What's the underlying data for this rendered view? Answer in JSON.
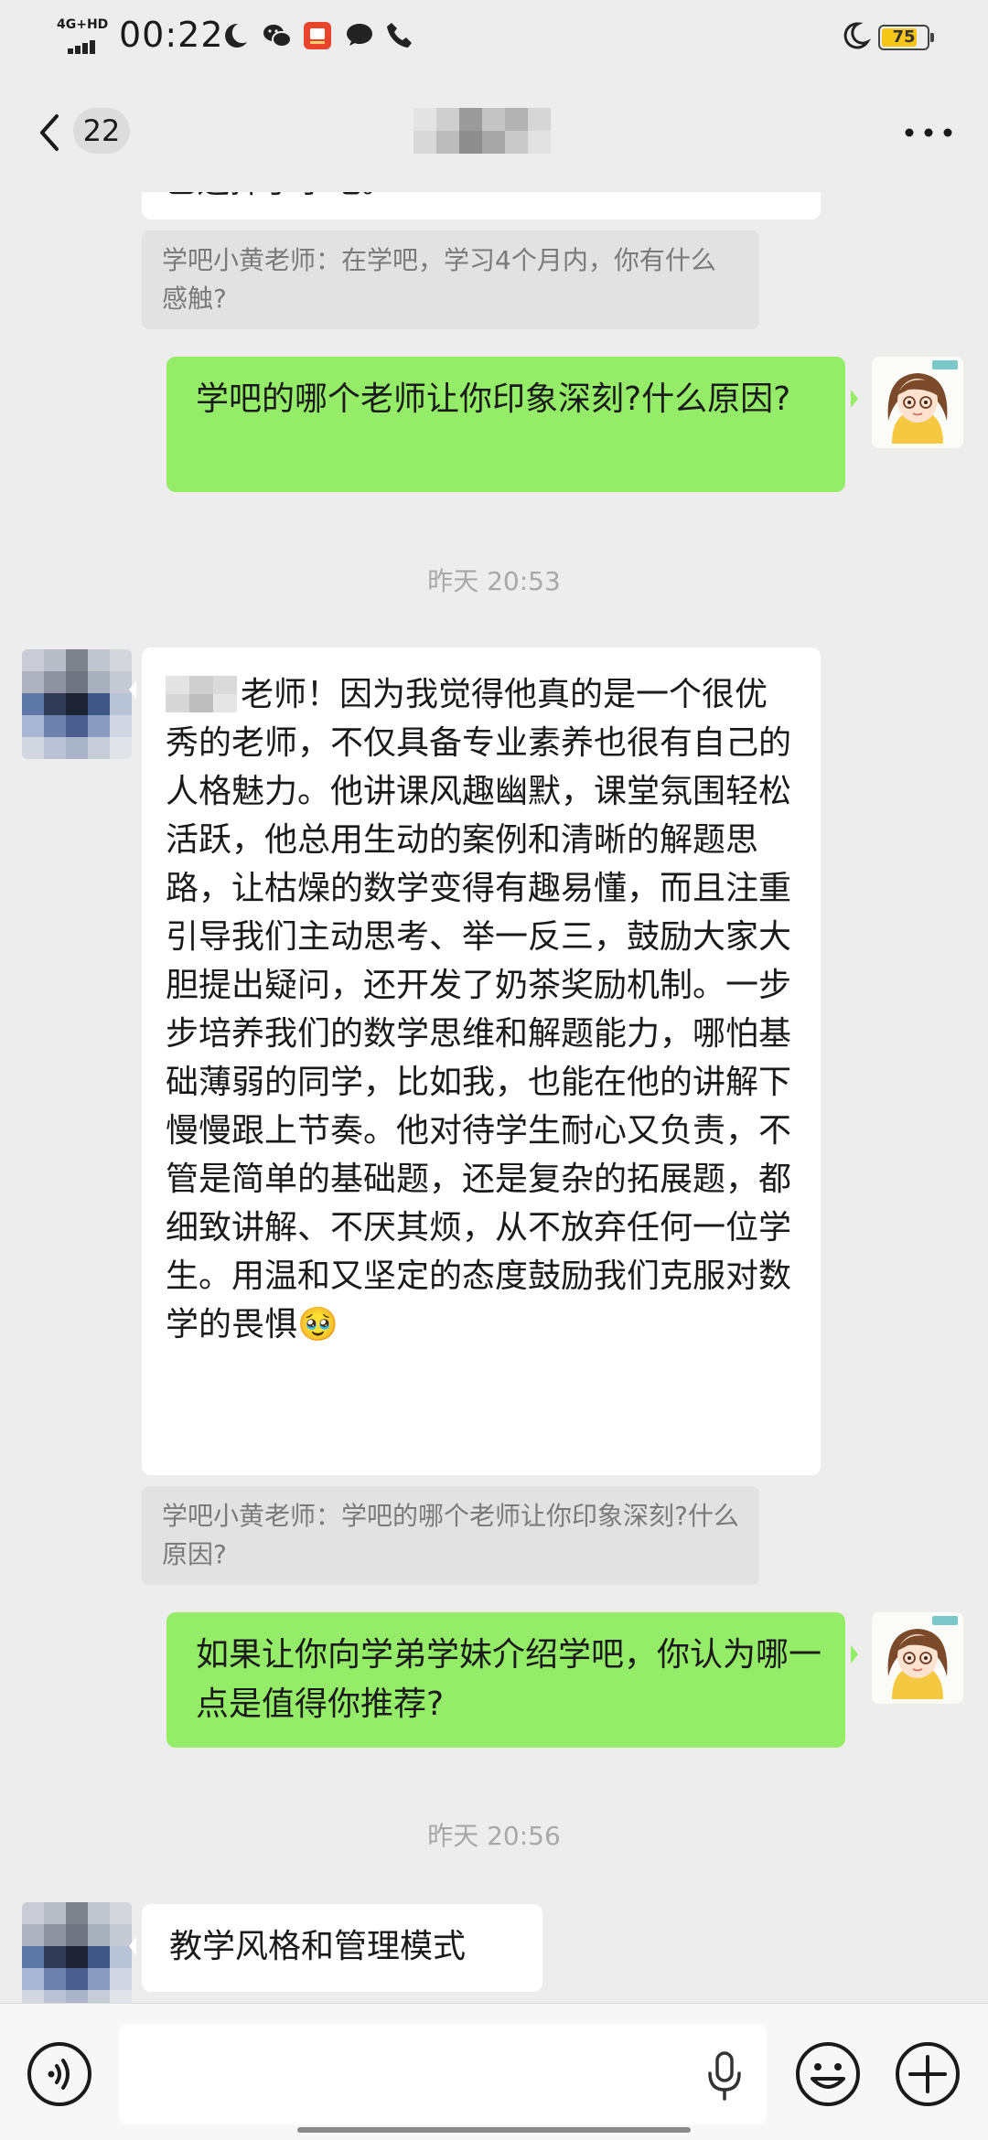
{
  "status_bar": {
    "network": "4G+HD",
    "time": "00:22",
    "icons": [
      "moon-icon",
      "wechat-icon",
      "app-notification-icon",
      "chat-bubble-icon",
      "phone-icon"
    ],
    "battery": "75"
  },
  "header": {
    "back_icon": "chevron-left-icon",
    "unread_count": "22",
    "more_icon": "more-dots-icon"
  },
  "messages": {
    "top_partial_text": "已选择了学吧。",
    "quote_1": "学吧小黄老师：在学吧，学习4个月内，你有什么感触?",
    "sent_1": "学吧的哪个老师让你印象深刻?什么原因?",
    "timestamp_1": "昨天 20:53",
    "reply_1": "老师！因为我觉得他真的是一个很优秀的老师，不仅具备专业素养也很有自己的人格魅力。他讲课风趣幽默，课堂氛围轻松活跃，他总用生动的案例和清晰的解题思路，让枯燥的数学变得有趣易懂，而且注重引导我们主动思考、举一反三，鼓励大家大胆提出疑问，还开发了奶茶奖励机制。一步步培养我们的数学思维和解题能力，哪怕基础薄弱的同学，比如我，也能在他的讲解下慢慢跟上节奏。他对待学生耐心又负责，不管是简单的基础题，还是复杂的拓展题，都细致讲解、不厌其烦，从不放弃任何一位学生。用温和又坚定的态度鼓励我们克服对数学的畏惧🥹",
    "quote_2": "学吧小黄老师：学吧的哪个老师让你印象深刻?什么原因?",
    "sent_2": "如果让你向学弟学妹介绍学吧，你认为哪一点是值得你推荐?",
    "timestamp_2": "昨天 20:56",
    "reply_2": "教学风格和管理模式"
  },
  "input_bar": {
    "voice_icon": "voice-input-icon",
    "mic_icon": "microphone-icon",
    "emoji_icon": "emoji-icon",
    "plus_icon": "plus-icon"
  },
  "colors": {
    "background": "#ededed",
    "sent_bubble": "#95ec69",
    "received_bubble": "#ffffff",
    "quote_bg": "#e2e2e2",
    "battery": "#f5c518"
  }
}
